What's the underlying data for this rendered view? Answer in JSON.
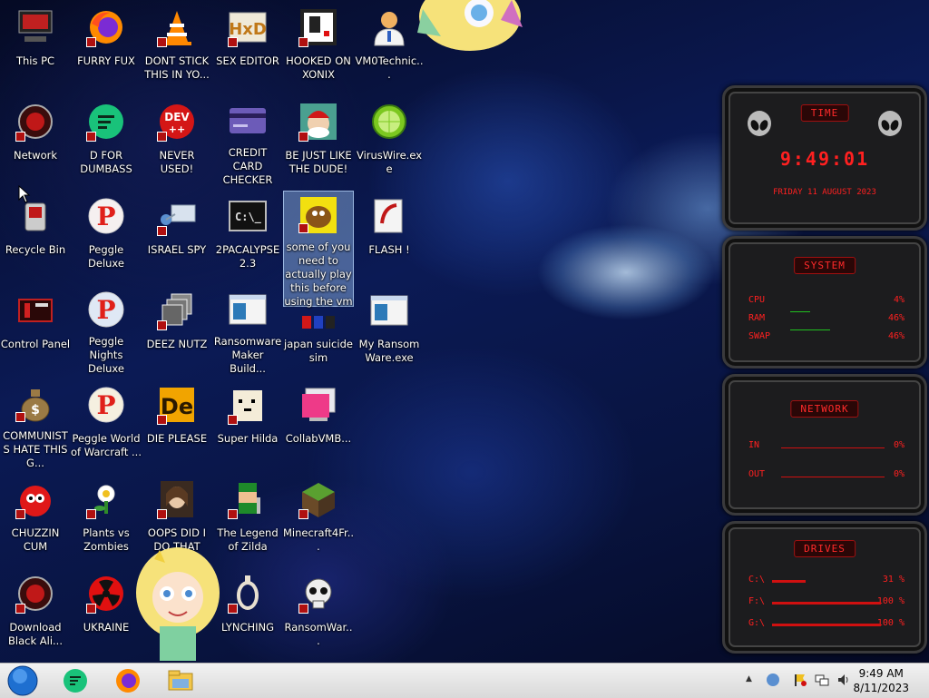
{
  "desktop": {
    "icons": [
      {
        "label": "This PC"
      },
      {
        "label": "FURRY FUX"
      },
      {
        "label": "DONT STICK THIS IN YO..."
      },
      {
        "label": "SEX EDITOR"
      },
      {
        "label": "HOOKED ON XONIX"
      },
      {
        "label": "VM0Technic..."
      },
      {
        "label": "Network"
      },
      {
        "label": "D FOR DUMBASS"
      },
      {
        "label": "NEVER USED!"
      },
      {
        "label": "CREDIT CARD CHECKER"
      },
      {
        "label": "BE JUST LIKE THE DUDE!"
      },
      {
        "label": "VirusWire.exe"
      },
      {
        "label": "Recycle Bin"
      },
      {
        "label": "Peggle Deluxe"
      },
      {
        "label": "ISRAEL SPY"
      },
      {
        "label": "2PACALYPSE 2.3"
      },
      {
        "label": "some of you need to actually play this before using the vm"
      },
      {
        "label": "FLASH !"
      },
      {
        "label": "Control Panel"
      },
      {
        "label": "Peggle Nights Deluxe"
      },
      {
        "label": "DEEZ NUTZ"
      },
      {
        "label": "Ransomware Maker Build..."
      },
      {
        "label": "japan suicide sim"
      },
      {
        "label": "My Ransom Ware.exe"
      },
      {
        "label": "COMMUNISTS HATE THIS G..."
      },
      {
        "label": "Peggle World of Warcraft ..."
      },
      {
        "label": "DIE PLEASE"
      },
      {
        "label": "Super Hilda"
      },
      {
        "label": "CollabVMB..."
      },
      {
        "label": "CHUZZIN CUM"
      },
      {
        "label": "Plants vs Zombies"
      },
      {
        "label": "OOPS DID I DO THAT"
      },
      {
        "label": "The Legend of Zilda"
      },
      {
        "label": "Minecraft4Fr..."
      },
      {
        "label": "Download Black Ali..."
      },
      {
        "label": "UKRAINE"
      },
      {
        "label": "LYNCHING"
      },
      {
        "label": "RansomWar..."
      }
    ],
    "icon_glyphs": {
      "dev": "DEV\n++",
      "de": "De",
      "peggle": "P",
      "cmd": "C:\\_"
    }
  },
  "widget": {
    "time": {
      "header": "TIME",
      "clock": "9:49:01",
      "date": "FRIDAY 11 AUGUST 2023"
    },
    "system": {
      "header": "SYSTEM",
      "rows": [
        {
          "label": "CPU",
          "value": "4%"
        },
        {
          "label": "RAM",
          "value": "46%"
        },
        {
          "label": "SWAP",
          "value": "46%"
        }
      ]
    },
    "network": {
      "header": "NETWORK",
      "rows": [
        {
          "label": "IN",
          "value": "0%"
        },
        {
          "label": "OUT",
          "value": "0%"
        }
      ]
    },
    "drives": {
      "header": "DRIVES",
      "rows": [
        {
          "label": "C:\\",
          "value": "31 %",
          "level": 0.31
        },
        {
          "label": "F:\\",
          "value": "100 %",
          "level": 1.0
        },
        {
          "label": "G:\\",
          "value": "100 %",
          "level": 1.0
        }
      ]
    }
  },
  "taskbar": {
    "time": "9:49 AM",
    "date": "8/11/2023",
    "tray_arrow": "▲",
    "colors": {
      "accent": "#1e90ff",
      "widget_red": "#ff2020"
    }
  }
}
